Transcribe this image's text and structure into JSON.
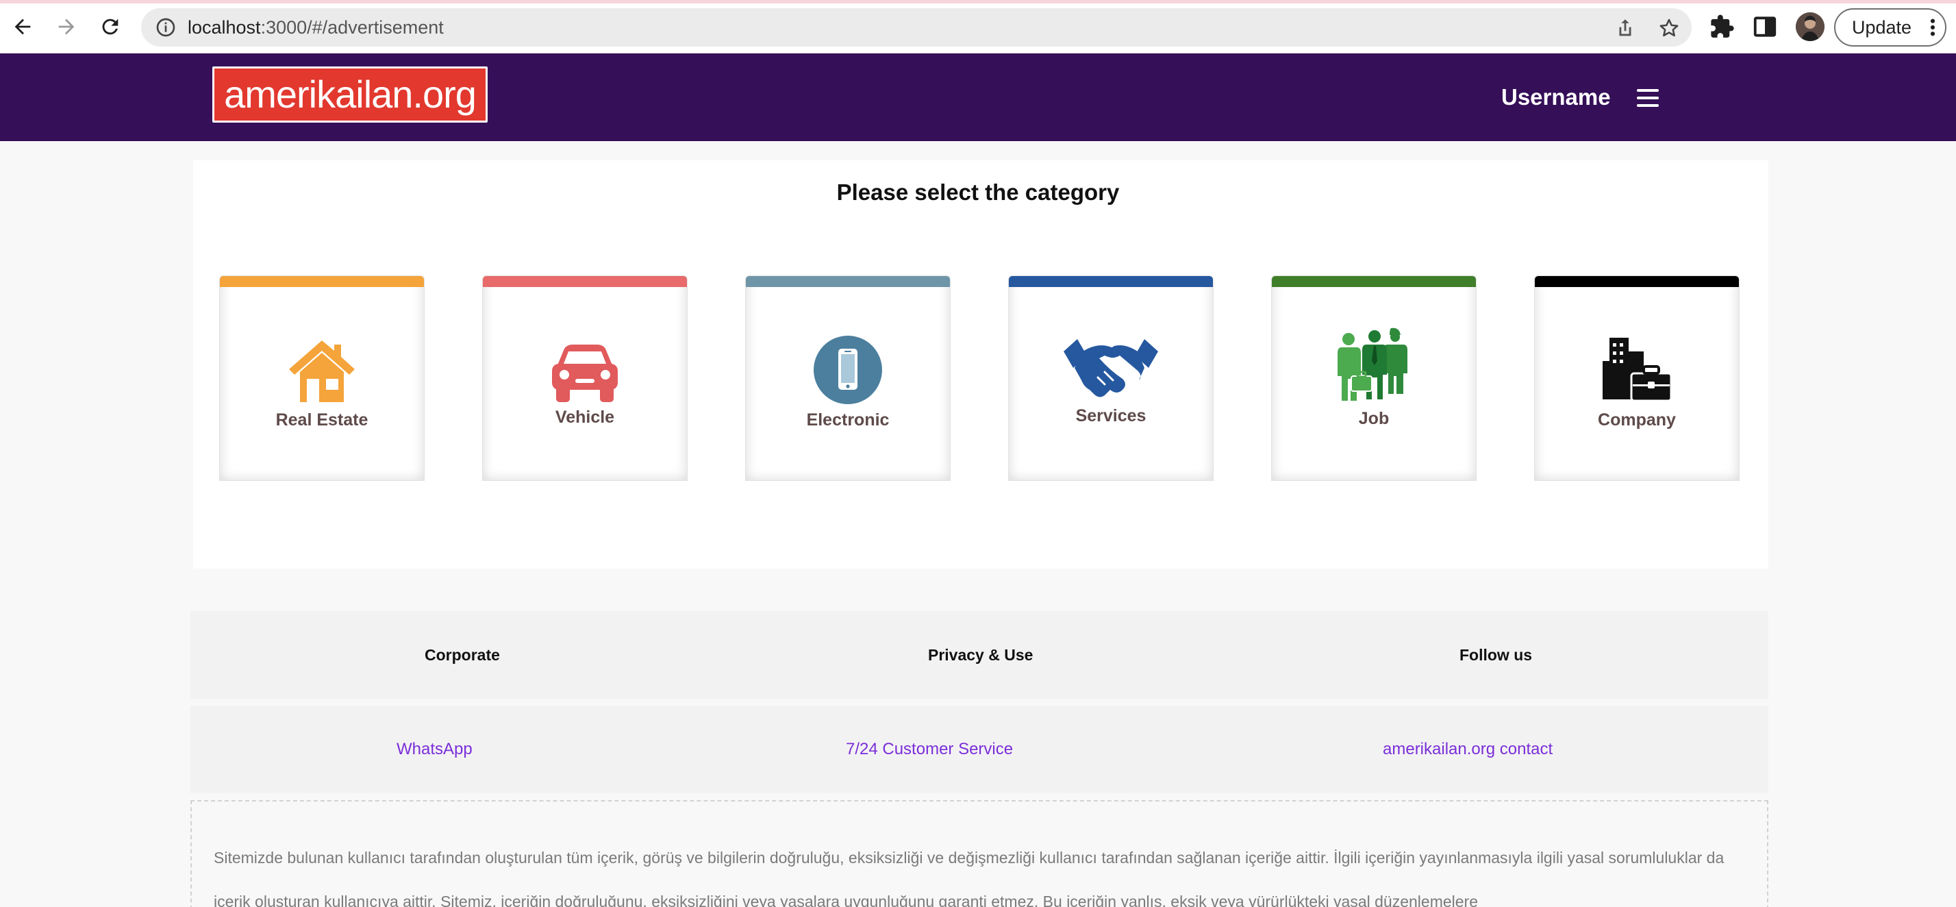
{
  "browser": {
    "url_host": "localhost",
    "url_rest": ":3000/#/advertisement",
    "update_label": "Update"
  },
  "site": {
    "logo_text": "amerikailan.org",
    "username": "Username"
  },
  "category_panel": {
    "title": "Please select the category",
    "categories": [
      {
        "label": "Real Estate",
        "icon": "house-icon",
        "color": "#f4a43a"
      },
      {
        "label": "Vehicle",
        "icon": "car-icon",
        "color": "#e86a6a"
      },
      {
        "label": "Electronic",
        "icon": "smartphone-icon",
        "color": "#6f96a8"
      },
      {
        "label": "Services",
        "icon": "handshake-icon",
        "color": "#25589f"
      },
      {
        "label": "Job",
        "icon": "workers-icon",
        "color": "#3f7f2a"
      },
      {
        "label": "Company",
        "icon": "office-briefcase-icon",
        "color": "#000000"
      }
    ]
  },
  "footer": {
    "headings": [
      "Corporate",
      "Privacy & Use",
      "Follow us"
    ],
    "links": [
      "WhatsApp",
      "7/24 Customer Service",
      "amerikailan.org contact"
    ],
    "disclaimer": "Sitemizde bulunan kullanıcı tarafından oluşturulan tüm içerik, görüş ve bilgilerin doğruluğu, eksiksizliği ve değişmezliği kullanıcı tarafından sağlanan içeriğe aittir. İlgili içeriğin yayınlanmasıyla ilgili yasal sorumluluklar da içerik oluşturan kullanıcıya aittir. Sitemiz, içeriğin doğruluğunu, eksiksizliğini veya yasalara uygunluğunu garanti etmez. Bu içeriğin yanlış, eksik veya yürürlükteki yasal düzenlemelere"
  },
  "colors": {
    "header_bg": "#350f58",
    "logo_bg": "#e2382e",
    "link": "#7a2fd8"
  }
}
